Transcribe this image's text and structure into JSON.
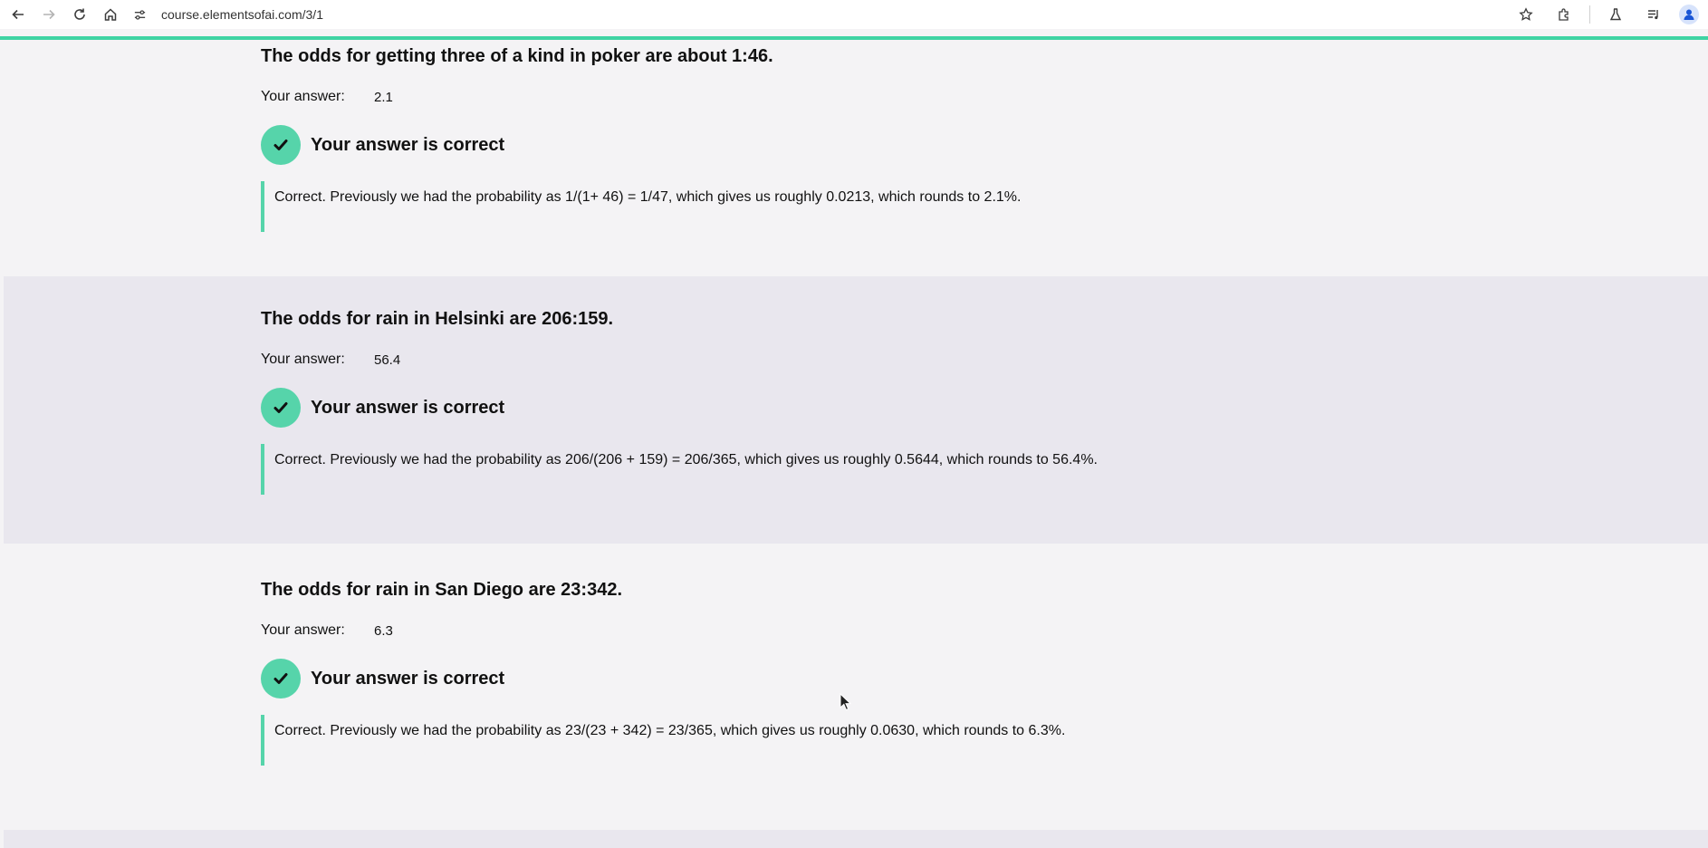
{
  "browser": {
    "url": "course.elementsofai.com/3/1"
  },
  "colors": {
    "accent": "#56d4aa",
    "progress": "#3fd3a3",
    "alt_background": "#e9e7ee",
    "background": "#f4f3f5"
  },
  "questions": [
    {
      "title": "The odds for getting three of a kind in poker are about 1:46.",
      "answer_label": "Your answer:",
      "answer_value": "2.1",
      "result": "Your answer is correct",
      "explanation": "Correct. Previously we had the probability as 1/(1+ 46) = 1/47, which gives us roughly 0.0213, which rounds to 2.1%."
    },
    {
      "title": "The odds for rain in Helsinki are 206:159.",
      "answer_label": "Your answer:",
      "answer_value": "56.4",
      "result": "Your answer is correct",
      "explanation": "Correct. Previously we had the probability as 206/(206 + 159) = 206/365, which gives us roughly 0.5644, which rounds to 56.4%."
    },
    {
      "title": "The odds for rain in San Diego are 23:342.",
      "answer_label": "Your answer:",
      "answer_value": "6.3",
      "result": "Your answer is correct",
      "explanation": "Correct. Previously we had the probability as 23/(23 + 342) = 23/365, which gives us roughly 0.0630, which rounds to 6.3%."
    }
  ]
}
